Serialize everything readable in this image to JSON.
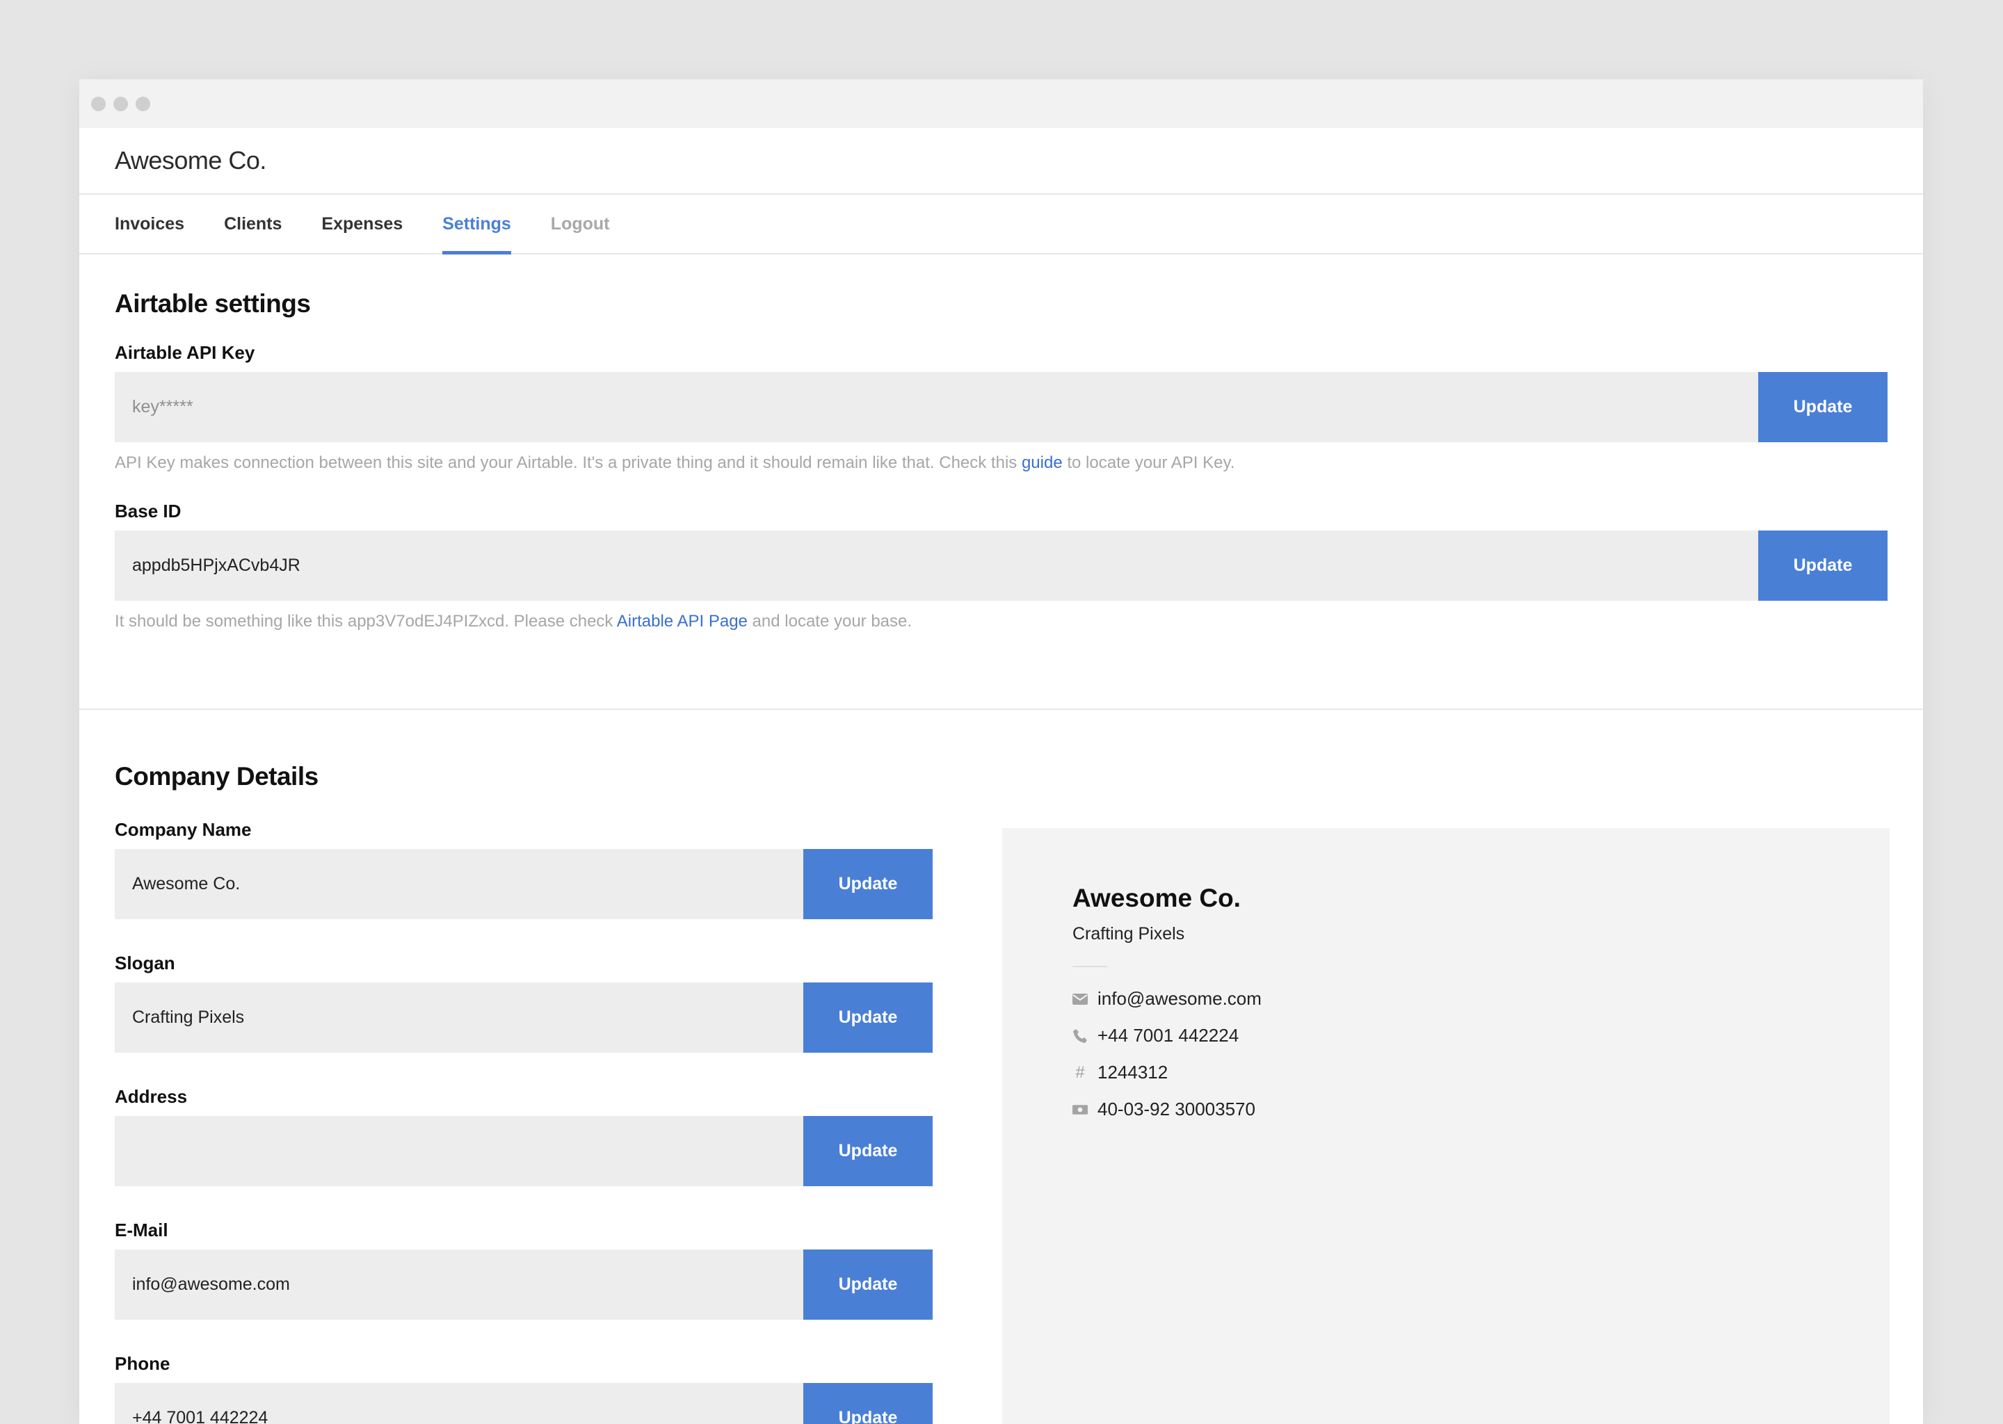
{
  "window": {
    "brand": "Awesome Co."
  },
  "nav": {
    "items": [
      {
        "label": "Invoices"
      },
      {
        "label": "Clients"
      },
      {
        "label": "Expenses"
      },
      {
        "label": "Settings",
        "active": true
      },
      {
        "label": "Logout"
      }
    ]
  },
  "airtable": {
    "title": "Airtable settings",
    "api_key": {
      "label": "Airtable API Key",
      "placeholder": "key*****",
      "button": "Update",
      "help_before": "API Key makes connection between this site and your Airtable. It's a private thing and it should remain like that. Check this ",
      "help_link": "guide",
      "help_after": " to locate your API Key."
    },
    "base_id": {
      "label": "Base ID",
      "value": "appdb5HPjxACvb4JR",
      "button": "Update",
      "help_before": "It should be something like this app3V7odEJ4PIZxcd. Please check ",
      "help_link": "Airtable API Page",
      "help_after": " and locate your base."
    }
  },
  "company": {
    "title": "Company Details",
    "fields": [
      {
        "label": "Company Name",
        "value": "Awesome Co.",
        "button": "Update"
      },
      {
        "label": "Slogan",
        "value": "Crafting Pixels",
        "button": "Update"
      },
      {
        "label": "Address",
        "value": "",
        "button": "Update"
      },
      {
        "label": "E-Mail",
        "value": "info@awesome.com",
        "button": "Update"
      },
      {
        "label": "Phone",
        "value": "+44 7001 442224",
        "button": "Update"
      }
    ],
    "preview": {
      "name": "Awesome Co.",
      "slogan": "Crafting Pixels",
      "email": "info@awesome.com",
      "phone": "+44 7001 442224",
      "number": "1244312",
      "bank": "40-03-92 30003570"
    }
  },
  "colors": {
    "accent": "#4a7fd6",
    "input_bg": "#ededed",
    "card_bg": "#f3f3f3"
  }
}
